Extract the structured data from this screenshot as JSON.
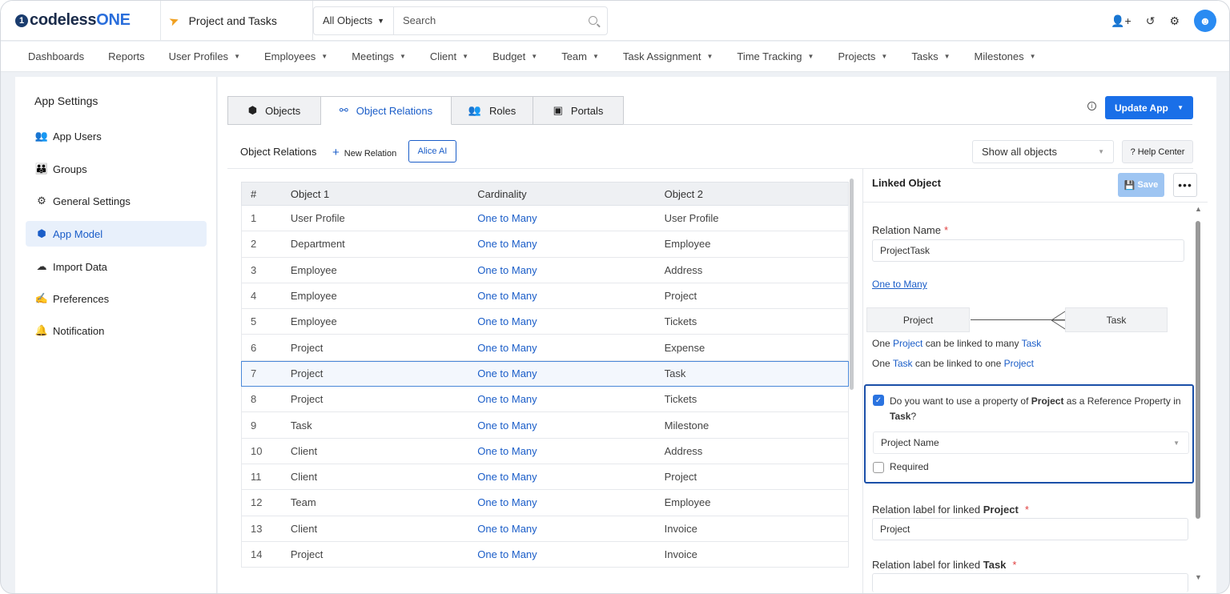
{
  "topbar": {
    "logo_mark": "1",
    "logo_prefix": "codeless",
    "logo_suffix": "ONE",
    "app_name": "Project and Tasks",
    "object_selector": "All Objects",
    "search_placeholder": "Search"
  },
  "nav": {
    "items": [
      {
        "label": "Dashboards",
        "dropdown": false
      },
      {
        "label": "Reports",
        "dropdown": false
      },
      {
        "label": "User Profiles",
        "dropdown": true
      },
      {
        "label": "Employees",
        "dropdown": true
      },
      {
        "label": "Meetings",
        "dropdown": true
      },
      {
        "label": "Client",
        "dropdown": true
      },
      {
        "label": "Budget",
        "dropdown": true
      },
      {
        "label": "Team",
        "dropdown": true
      },
      {
        "label": "Task Assignment",
        "dropdown": true
      },
      {
        "label": "Time Tracking",
        "dropdown": true
      },
      {
        "label": "Projects",
        "dropdown": true
      },
      {
        "label": "Tasks",
        "dropdown": true
      },
      {
        "label": "Milestones",
        "dropdown": true
      }
    ]
  },
  "settings": {
    "title": "App Settings",
    "items": [
      {
        "label": "App Users",
        "icon": "users-icon"
      },
      {
        "label": "Groups",
        "icon": "groups-icon"
      },
      {
        "label": "General Settings",
        "icon": "gear-icon"
      },
      {
        "label": "App Model",
        "icon": "cube-icon",
        "active": true
      },
      {
        "label": "Import Data",
        "icon": "cloud-upload-icon"
      },
      {
        "label": "Preferences",
        "icon": "hand-icon"
      },
      {
        "label": "Notification",
        "icon": "bell-icon"
      }
    ]
  },
  "tabs": {
    "objects": "Objects",
    "relations": "Object Relations",
    "roles": "Roles",
    "portals": "Portals"
  },
  "toolbar": {
    "update_app": "Update App",
    "section_title": "Object Relations",
    "new_relation": "New Relation",
    "alice_ai": "Alice AI",
    "filter_value": "Show all objects",
    "help_center": "? Help Center"
  },
  "table": {
    "headers": {
      "num": "#",
      "obj1": "Object 1",
      "card": "Cardinality",
      "obj2": "Object 2"
    },
    "rows": [
      {
        "num": "1",
        "obj1": "User Profile",
        "card": "One to Many",
        "obj2": "User Profile"
      },
      {
        "num": "2",
        "obj1": "Department",
        "card": "One to Many",
        "obj2": "Employee"
      },
      {
        "num": "3",
        "obj1": "Employee",
        "card": "One to Many",
        "obj2": "Address"
      },
      {
        "num": "4",
        "obj1": "Employee",
        "card": "One to Many",
        "obj2": "Project"
      },
      {
        "num": "5",
        "obj1": "Employee",
        "card": "One to Many",
        "obj2": "Tickets"
      },
      {
        "num": "6",
        "obj1": "Project",
        "card": "One to Many",
        "obj2": "Expense"
      },
      {
        "num": "7",
        "obj1": "Project",
        "card": "One to Many",
        "obj2": "Task",
        "selected": true
      },
      {
        "num": "8",
        "obj1": "Project",
        "card": "One to Many",
        "obj2": "Tickets"
      },
      {
        "num": "9",
        "obj1": "Task",
        "card": "One to Many",
        "obj2": "Milestone"
      },
      {
        "num": "10",
        "obj1": "Client",
        "card": "One to Many",
        "obj2": "Address"
      },
      {
        "num": "11",
        "obj1": "Client",
        "card": "One to Many",
        "obj2": "Project"
      },
      {
        "num": "12",
        "obj1": "Team",
        "card": "One to Many",
        "obj2": "Employee"
      },
      {
        "num": "13",
        "obj1": "Client",
        "card": "One to Many",
        "obj2": "Invoice"
      },
      {
        "num": "14",
        "obj1": "Project",
        "card": "One to Many",
        "obj2": "Invoice"
      }
    ]
  },
  "detail": {
    "title": "Linked Object",
    "save": "Save",
    "more": "•••",
    "relation_name_label": "Relation Name",
    "relation_name_value": "ProjectTask",
    "cardinality_link": "One to Many",
    "object_one": "Project",
    "object_two": "Task",
    "sentence1": {
      "pre": "One ",
      "a": "Project",
      "mid": " can be linked to many ",
      "b": "Task"
    },
    "sentence2": {
      "pre": "One ",
      "a": "Task",
      "mid": " can be linked to one ",
      "b": "Project"
    },
    "ref_question": {
      "pre": "Do you want to use a property of ",
      "a": "Project",
      "mid": " as a Reference Property in ",
      "b": "Task",
      "post": "?"
    },
    "ref_property": "Project Name",
    "required_label": "Required",
    "label_linked_project": {
      "pre": "Relation label for linked ",
      "obj": "Project"
    },
    "label_linked_project_value": "Project",
    "label_linked_task": {
      "pre": "Relation label for linked ",
      "obj": "Task"
    },
    "required_mark": "*"
  }
}
